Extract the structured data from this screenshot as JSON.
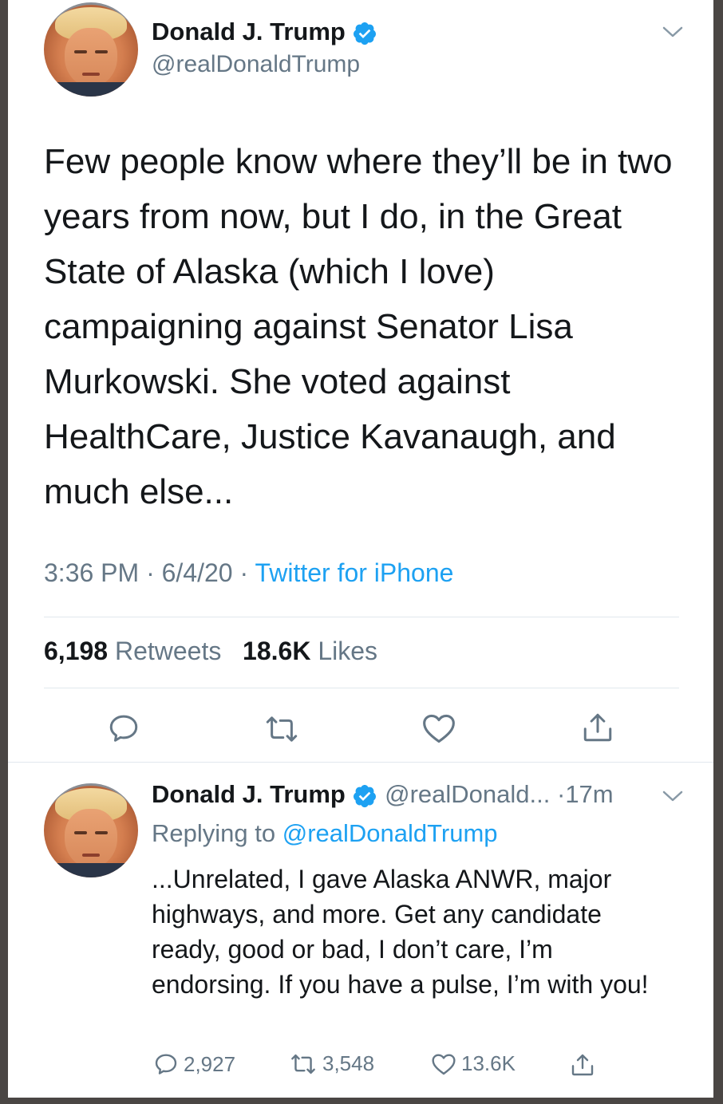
{
  "main_tweet": {
    "author_name": "Donald J. Trump",
    "author_handle": "@realDonaldTrump",
    "text": "Few people know where they’ll be in two years from now, but I do, in the Great State of Alaska (which I love) campaigning against Senator Lisa Murkowski. She voted against HealthCare, Justice Kavanaugh, and much else...",
    "time": "3:36 PM",
    "date": "6/4/20",
    "source": "Twitter for iPhone",
    "retweets_count": "6,198",
    "retweets_label": "Retweets",
    "likes_count": "18.6K",
    "likes_label": "Likes",
    "icons": [
      "verified-badge-icon",
      "chevron-down-icon",
      "reply-icon",
      "retweet-icon",
      "like-icon",
      "share-icon"
    ]
  },
  "reply_tweet": {
    "author_name": "Donald J. Trump",
    "author_handle": "@realDonald...",
    "age": "17m",
    "replying_label": "Replying to",
    "replying_to": "@realDonaldTrump",
    "text": "...Unrelated, I gave Alaska ANWR, major highways, and more. Get any candidate ready, good or bad, I don’t care, I’m endorsing. If you have a pulse, I’m with you!",
    "reply_count": "2,927",
    "retweet_count": "3,548",
    "like_count": "13.6K"
  },
  "colors": {
    "accent": "#1da1f2",
    "secondary_text": "#657786",
    "primary_text": "#14171a",
    "background": "#4a4644"
  }
}
